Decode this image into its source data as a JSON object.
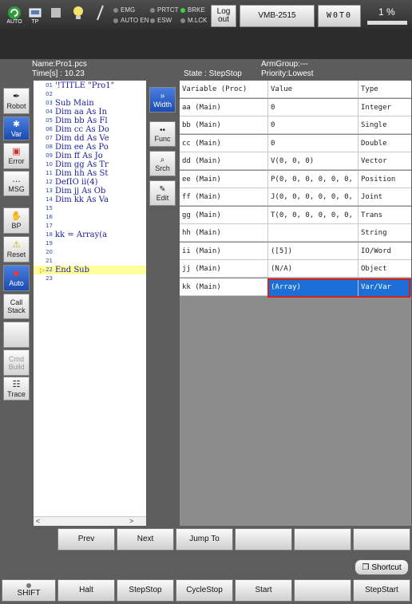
{
  "topbar": {
    "auto_label": "AUTO",
    "tp_label": "TP",
    "status": {
      "emg": "EMG",
      "autoen": "AUTO EN",
      "prtct": "PRTCT",
      "esw": "ESW",
      "brke": "BRKE",
      "mlck": "M.LCK"
    },
    "logout_label": "Log out",
    "robot_name": "VMB-2515",
    "coord": "W0T0",
    "speed": "1 %"
  },
  "info": {
    "name": "Name:Pro1.pcs",
    "time": "Time[s] : 10.23",
    "state": "State : StepStop",
    "armgroup": "ArmGroup:---",
    "priority": "Priority:Lowest"
  },
  "leftnav": [
    {
      "label": "Robot"
    },
    {
      "label": "Var"
    },
    {
      "label": "Error"
    },
    {
      "label": "MSG"
    },
    {
      "label": "BP"
    },
    {
      "label": "Reset"
    },
    {
      "label": "Auto"
    },
    {
      "label": "Call Stack"
    },
    {
      "label": ""
    },
    {
      "label": "Cmd Build"
    },
    {
      "label": "Trace"
    }
  ],
  "code": [
    {
      "n": "01",
      "t": "'!TITLE \"Pro1\""
    },
    {
      "n": "02",
      "t": ""
    },
    {
      "n": "03",
      "t": "Sub Main"
    },
    {
      "n": "04",
      "t": "    Dim aa As In"
    },
    {
      "n": "05",
      "t": "    Dim bb As Fl"
    },
    {
      "n": "06",
      "t": "    Dim cc As Do"
    },
    {
      "n": "07",
      "t": "    Dim dd As Ve"
    },
    {
      "n": "08",
      "t": "    Dim ee As Po"
    },
    {
      "n": "09",
      "t": "    Dim ff As Jo"
    },
    {
      "n": "10",
      "t": "    Dim gg As Tr"
    },
    {
      "n": "11",
      "t": "    Dim hh As St"
    },
    {
      "n": "12",
      "t": "    DefIO ii(4)"
    },
    {
      "n": "13",
      "t": "    Dim jj As Ob"
    },
    {
      "n": "14",
      "t": "    Dim kk As Va"
    },
    {
      "n": "15",
      "t": ""
    },
    {
      "n": "16",
      "t": ""
    },
    {
      "n": "17",
      "t": ""
    },
    {
      "n": "18",
      "t": "    kk = Array(a"
    },
    {
      "n": "19",
      "t": ""
    },
    {
      "n": "20",
      "t": ""
    },
    {
      "n": "21",
      "t": ""
    },
    {
      "n": "22",
      "t": "End Sub"
    },
    {
      "n": "23",
      "t": ""
    }
  ],
  "scroll": {
    "left": "<",
    "right": ">"
  },
  "midbuttons": [
    {
      "label": "Width"
    },
    {
      "label": "Func"
    },
    {
      "label": "Srch"
    },
    {
      "label": "Edit"
    }
  ],
  "vartable": {
    "headers": [
      "Variable (Proc)",
      "Value",
      "Type"
    ],
    "rows": [
      [
        "aa (Main)",
        "0",
        "Integer"
      ],
      [
        "bb (Main)",
        "0",
        "Single"
      ],
      [
        "cc (Main)",
        "0",
        "Double"
      ],
      [
        "dd (Main)",
        "V(0, 0, 0)",
        "Vector"
      ],
      [
        "ee (Main)",
        "P(0, 0, 0, 0, 0, 0, -1",
        "Position"
      ],
      [
        "ff (Main)",
        "J(0, 0, 0, 0, 0, 0, 0,",
        "Joint"
      ],
      [
        "gg (Main)",
        "T(0, 0, 0, 0, 0, 0, 0,",
        "Trans"
      ],
      [
        "hh (Main)",
        "",
        "String"
      ],
      [
        "ii (Main)",
        "([5])",
        "IO/Word"
      ],
      [
        "jj (Main)",
        "(N/A)",
        "Object"
      ],
      [
        "kk (Main)",
        "(Array)",
        "Var/Var"
      ]
    ]
  },
  "bottomrow1": [
    "Prev",
    "Next",
    "Jump To",
    "",
    "",
    ""
  ],
  "shortcut_label": "Shortcut",
  "bottomrow2": [
    "SHIFT",
    "Halt",
    "StepStop",
    "CycleStop",
    "Start",
    "",
    "StepStart"
  ],
  "colors": {
    "selection": "#1c6fd6",
    "highlight_line": "#fefe9a",
    "box": "#d62020"
  }
}
